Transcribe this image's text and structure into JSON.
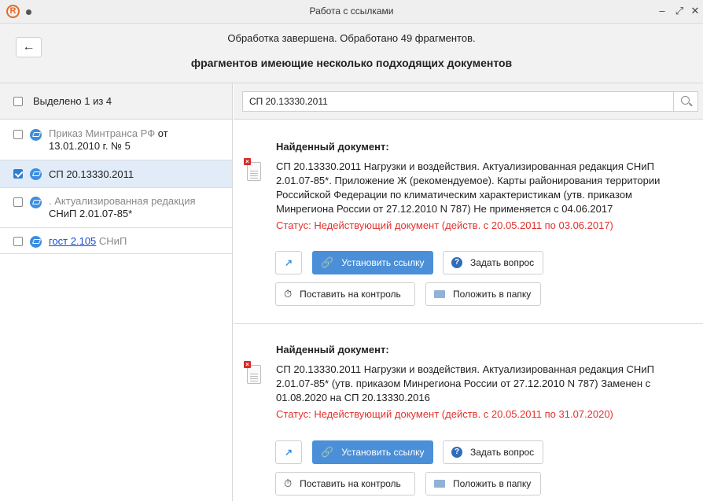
{
  "window": {
    "logo": "R",
    "title": "Работа с ссылками",
    "minimize": "–",
    "maximize": "⤢",
    "close": "✕"
  },
  "header": {
    "back": "←",
    "status": "Обработка завершена. Обработано 49 фрагментов.",
    "title": "фрагментов имеющие несколько подходящих документов"
  },
  "sidebar": {
    "selection_label": "Выделено 1 из 4",
    "items": [
      {
        "checked": false,
        "text_gray": "Приказ Минтранса РФ",
        "text_dark": " от 13.01.2010 г. № 5"
      },
      {
        "checked": true,
        "text_dark": "СП 20.13330.2011"
      },
      {
        "checked": false,
        "text_gray": ". Актуализированная редакция",
        "text_dark": " СНиП 2.01.07-85*"
      },
      {
        "checked": false,
        "text_link": "гост 2.105",
        "text_gray": " СНиП"
      }
    ]
  },
  "search": {
    "value": "СП 20.13330.2011",
    "placeholder": ""
  },
  "cards": [
    {
      "heading": "Найденный документ:",
      "description": "СП 20.13330.2011 Нагрузки и воздействия. Актуализированная редакция СНиП 2.01.07-85*. Приложение Ж (рекомендуемое). Карты районирования территории Российской Федерации по климатическим характеристикам (утв. приказом Минрегиона России от 27.12.2010 N 787) Не применяется с 04.06.2017",
      "status": "Статус: Недействующий документ (действ. с 20.05.2011 по 03.06.2017)",
      "btn_link": "Установить ссылку",
      "btn_ask": "Задать вопрос",
      "btn_control": "Поставить на контроль",
      "btn_folder": "Положить в папку"
    },
    {
      "heading": "Найденный документ:",
      "description": "СП 20.13330.2011 Нагрузки и воздействия. Актуализированная редакция СНиП 2.01.07-85* (утв. приказом Минрегиона России от 27.12.2010 N 787) Заменен с 01.08.2020 на СП 20.13330.2016",
      "status": "Статус: Недействующий документ (действ. с 20.05.2011 по 31.07.2020)",
      "btn_link": "Установить ссылку",
      "btn_ask": "Задать вопрос",
      "btn_control": "Поставить на контроль",
      "btn_folder": "Положить в папку"
    }
  ],
  "colors": {
    "accent": "#4a8fd8",
    "status_red": "#e3312d",
    "link": "#1a4fc9",
    "selected_row": "#e1ecf8"
  },
  "icons": {
    "open": "external-link-icon",
    "link": "chain-link-icon",
    "ask": "question-icon",
    "control": "stopwatch-icon",
    "folder": "folder-icon",
    "document": "document-icon"
  }
}
